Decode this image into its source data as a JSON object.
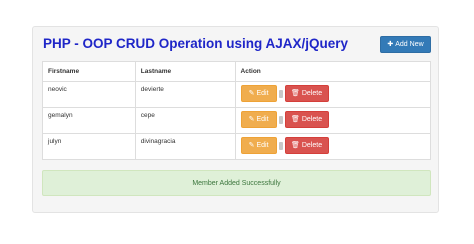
{
  "header": {
    "title": "PHP - OOP CRUD Operation using AJAX/jQuery",
    "add_button": {
      "icon": "plus-icon",
      "label": "Add New"
    }
  },
  "table": {
    "columns": [
      "Firstname",
      "Lastname",
      "Action"
    ],
    "rows": [
      {
        "firstname": "neovic",
        "lastname": "devierte"
      },
      {
        "firstname": "gemalyn",
        "lastname": "cepe"
      },
      {
        "firstname": "julyn",
        "lastname": "divinagracia"
      }
    ],
    "edit_label": "Edit",
    "delete_label": "Delete",
    "edit_icon": "edit-icon",
    "delete_icon": "trash-icon"
  },
  "alert": {
    "message": "Member Added Successfully"
  },
  "colors": {
    "title": "#1f26c8",
    "primary": "#337ab7",
    "warning": "#f0ad4e",
    "danger": "#d9534f",
    "success_bg": "#dff0d8",
    "success_text": "#3c763d"
  }
}
